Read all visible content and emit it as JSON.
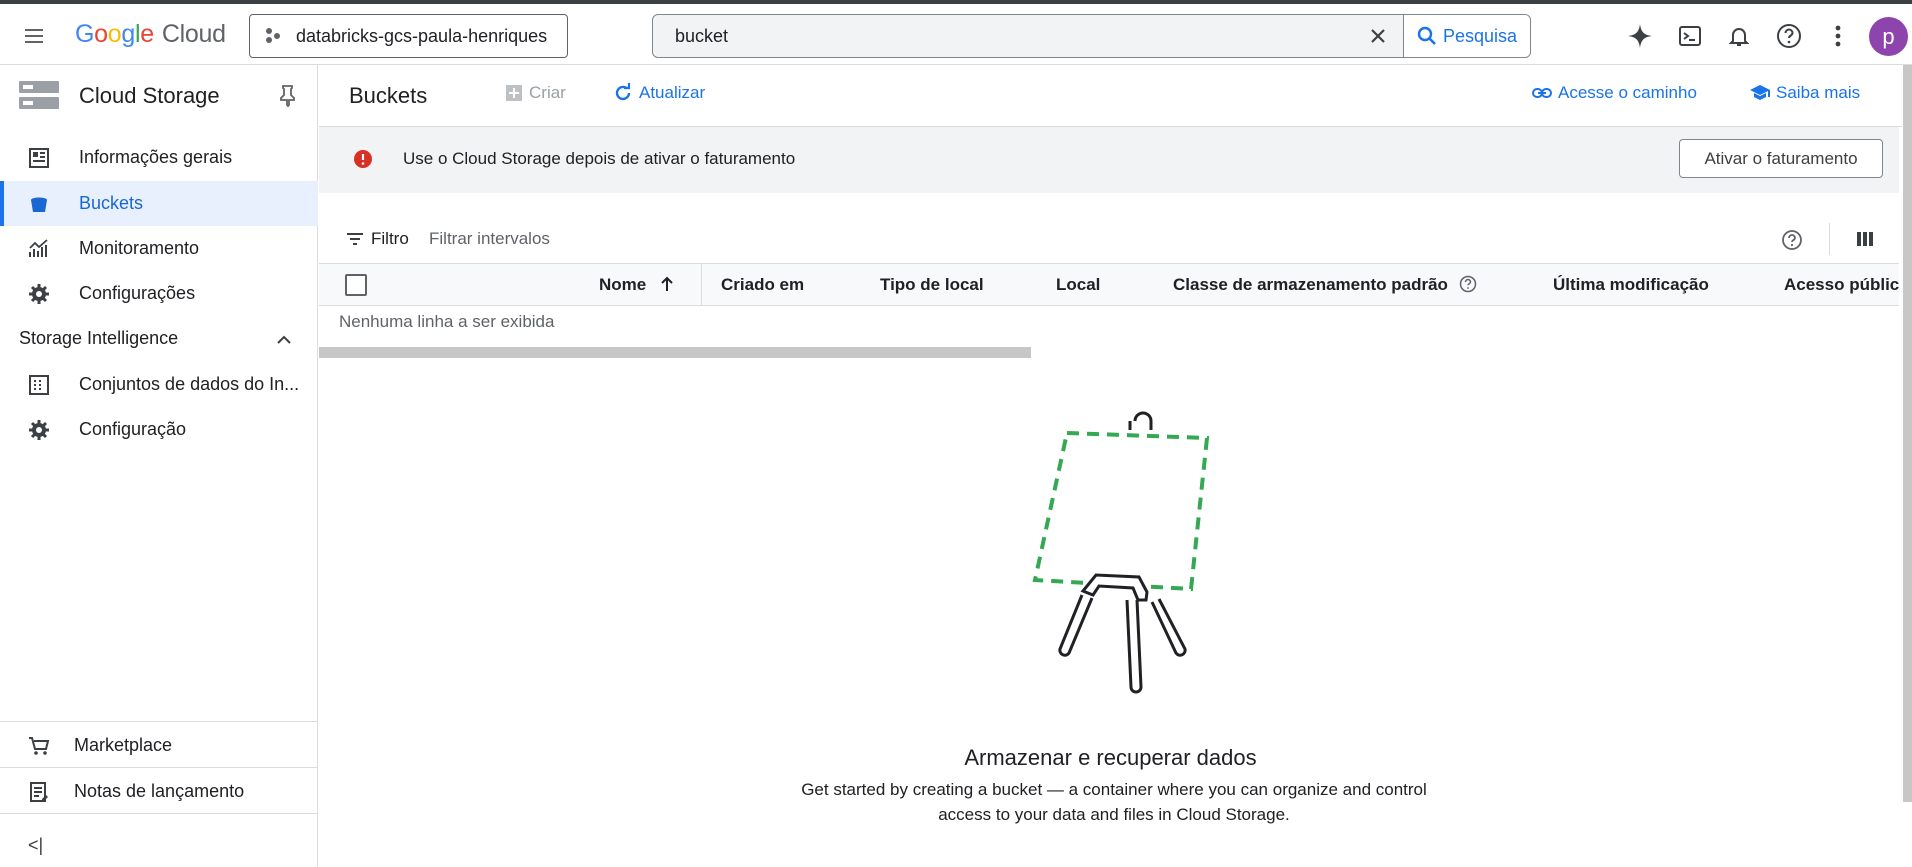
{
  "topbar": {
    "logo_google": [
      "G",
      "o",
      "o",
      "g",
      "l",
      "e"
    ],
    "logo_cloud": "Cloud",
    "project": "databricks-gcs-paula-henriques",
    "search_value": "bucket",
    "search_button": "Pesquisa",
    "avatar_letter": "p"
  },
  "sidebar": {
    "title": "Cloud Storage",
    "items": [
      {
        "label": "Informações gerais",
        "icon": "dashboard-icon"
      },
      {
        "label": "Buckets",
        "icon": "bucket-icon",
        "active": true
      },
      {
        "label": "Monitoramento",
        "icon": "chart-icon"
      },
      {
        "label": "Configurações",
        "icon": "gear-icon"
      }
    ],
    "section_title": "Storage Intelligence",
    "section_items": [
      {
        "label": "Conjuntos de dados do In...",
        "icon": "dataset-icon"
      },
      {
        "label": "Configuração",
        "icon": "gear-icon"
      }
    ],
    "bottom_items": [
      {
        "label": "Marketplace",
        "icon": "cart-icon"
      },
      {
        "label": "Notas de lançamento",
        "icon": "notes-icon"
      }
    ],
    "collapse_label": "<|"
  },
  "main": {
    "title": "Buckets",
    "actions": {
      "create": "Criar",
      "refresh": "Atualizar",
      "access_path": "Acesse o caminho",
      "learn_more": "Saiba mais"
    },
    "banner": {
      "text": "Use o Cloud Storage depois de ativar o faturamento",
      "button": "Ativar o faturamento"
    },
    "filter": {
      "label": "Filtro",
      "placeholder": "Filtrar intervalos"
    },
    "table": {
      "columns": [
        "Nome",
        "Criado em",
        "Tipo de local",
        "Local",
        "Classe de armazenamento padrão",
        "Última modificação",
        "Acesso público"
      ],
      "empty_text": "Nenhuma linha a ser exibida"
    },
    "empty_state": {
      "title": "Armazenar e recuperar dados",
      "description": "Get started by creating a bucket — a container where you can organize and control access to your data and files in Cloud Storage."
    }
  },
  "colors": {
    "accent": "#1a73e8",
    "error": "#d93025",
    "illustration_green": "#34a853",
    "avatar": "#8e44ad"
  }
}
